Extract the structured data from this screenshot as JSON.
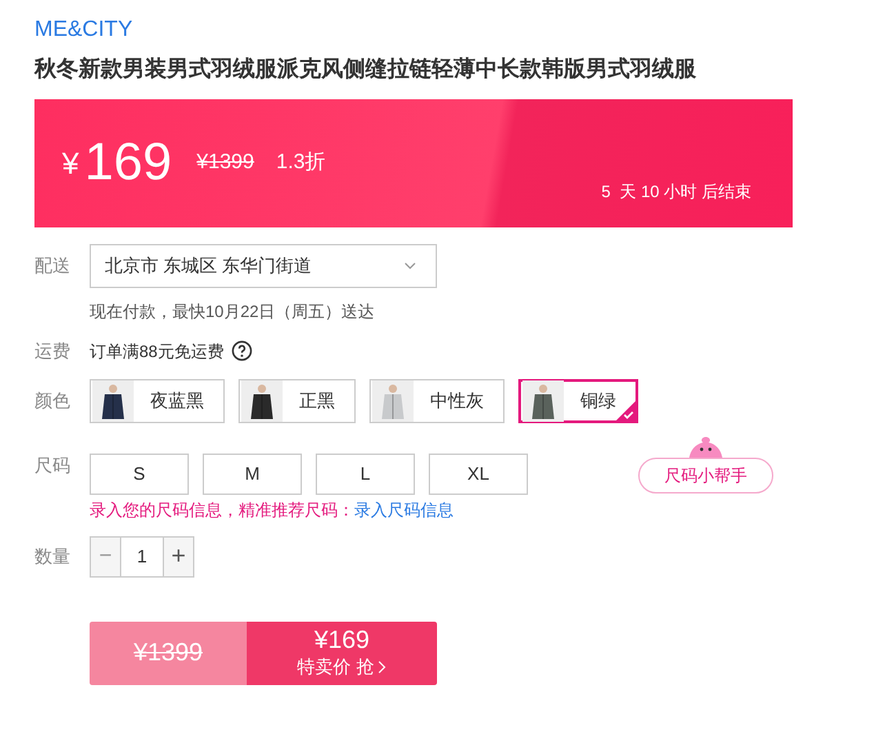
{
  "brand": "ME&CITY",
  "title": "秋冬新款男装男式羽绒服派克风侧缝拉链轻薄中长款韩版男式羽绒服",
  "price_banner": {
    "currency": "¥",
    "price": "169",
    "original_price": "¥1399",
    "discount": "1.3折",
    "countdown": "5  天 10 小时 后结束"
  },
  "delivery": {
    "label": "配送",
    "address": "北京市 东城区 东华门街道",
    "eta": "现在付款，最快10月22日（周五）送达"
  },
  "shipping": {
    "label": "运费",
    "text": "订单满88元免运费"
  },
  "colors": {
    "label": "颜色",
    "options": [
      {
        "name": "夜蓝黑",
        "selected": false
      },
      {
        "name": "正黑",
        "selected": false
      },
      {
        "name": "中性灰",
        "selected": false
      },
      {
        "name": "铜绿",
        "selected": true
      }
    ]
  },
  "sizes": {
    "label": "尺码",
    "options": [
      {
        "name": "S",
        "selected": false
      },
      {
        "name": "M",
        "selected": false
      },
      {
        "name": "L",
        "selected": false
      },
      {
        "name": "XL",
        "selected": false
      }
    ],
    "helper": "尺码小帮手",
    "hint": "录入您的尺码信息，精准推荐尺码：",
    "hint_link": "录入尺码信息"
  },
  "quantity": {
    "label": "数量",
    "decrease": "−",
    "value": "1",
    "increase": "+",
    "decrease_disabled": true
  },
  "buy": {
    "original_price": "¥1399",
    "price": "¥169",
    "action": "特卖价 抢"
  }
}
